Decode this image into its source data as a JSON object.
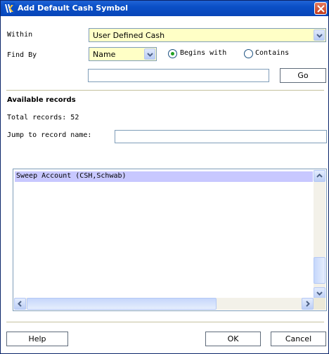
{
  "window": {
    "title": "Add Default Cash Symbol"
  },
  "within": {
    "label": "Within",
    "value": "User Defined Cash"
  },
  "find_by": {
    "label": "Find By",
    "value": "Name",
    "option_begins": "Begins with",
    "option_contains": "Contains",
    "selected": "Begins with"
  },
  "search": {
    "value": "",
    "go_label": "Go"
  },
  "available": {
    "heading": "Available records",
    "total": "Total records: 52",
    "jump_label": "Jump to record name:",
    "jump_value": ""
  },
  "records": [
    "Sweep Account (CSH,Schwab)"
  ],
  "footer": {
    "help_label": "Help",
    "ok_label": "OK",
    "cancel_label": "Cancel"
  },
  "colors": {
    "title_bar": "#0a4fc6",
    "combo_bg": "#ffffc6",
    "selected_row": "#c8c8ff",
    "radio_dot": "#21a121"
  }
}
